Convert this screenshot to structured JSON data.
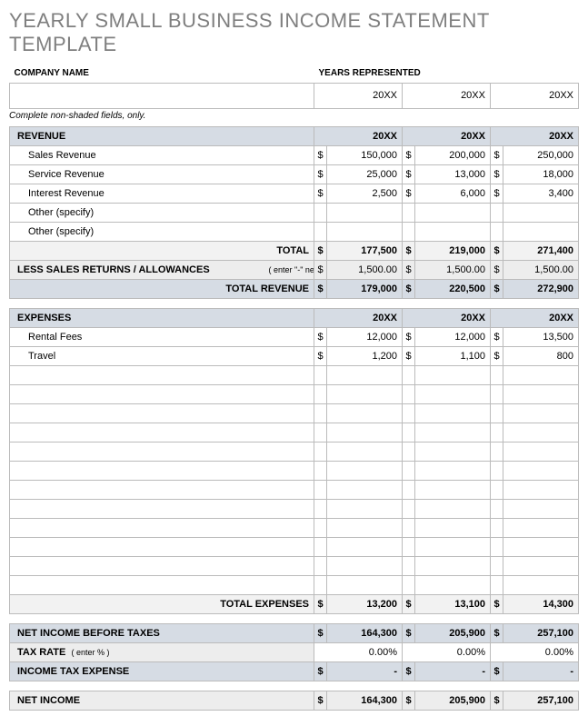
{
  "title": "YEARLY SMALL BUSINESS INCOME STATEMENT TEMPLATE",
  "header": {
    "company_label": "COMPANY NAME",
    "years_label": "YEARS REPRESENTED",
    "year1": "20XX",
    "year2": "20XX",
    "year3": "20XX"
  },
  "note": "Complete non-shaded fields, only.",
  "revenue": {
    "section_label": "REVENUE",
    "y1": "20XX",
    "y2": "20XX",
    "y3": "20XX",
    "rows": [
      {
        "label": "Sales Revenue",
        "v1": "150,000",
        "v2": "200,000",
        "v3": "250,000"
      },
      {
        "label": "Service Revenue",
        "v1": "25,000",
        "v2": "13,000",
        "v3": "18,000"
      },
      {
        "label": "Interest Revenue",
        "v1": "2,500",
        "v2": "6,000",
        "v3": "3,400"
      },
      {
        "label": "Other (specify)",
        "v1": "",
        "v2": "",
        "v3": ""
      },
      {
        "label": "Other (specify)",
        "v1": "",
        "v2": "",
        "v3": ""
      }
    ],
    "total_label": "TOTAL",
    "total": {
      "v1": "177,500",
      "v2": "219,000",
      "v3": "271,400"
    },
    "less_returns_label": "LESS SALES RETURNS / ALLOWANCES",
    "less_returns_hint": "( enter \"-\" negative amou",
    "less_returns": {
      "v1": "1,500.00",
      "v2": "1,500.00",
      "v3": "1,500.00"
    },
    "total_revenue_label": "TOTAL REVENUE",
    "total_revenue": {
      "v1": "179,000",
      "v2": "220,500",
      "v3": "272,900"
    }
  },
  "expenses": {
    "section_label": "EXPENSES",
    "y1": "20XX",
    "y2": "20XX",
    "y3": "20XX",
    "rows": [
      {
        "label": "Rental Fees",
        "v1": "12,000",
        "v2": "12,000",
        "v3": "13,500"
      },
      {
        "label": "Travel",
        "v1": "1,200",
        "v2": "1,100",
        "v3": "800"
      },
      {
        "label": "",
        "v1": "",
        "v2": "",
        "v3": ""
      },
      {
        "label": "",
        "v1": "",
        "v2": "",
        "v3": ""
      },
      {
        "label": "",
        "v1": "",
        "v2": "",
        "v3": ""
      },
      {
        "label": "",
        "v1": "",
        "v2": "",
        "v3": ""
      },
      {
        "label": "",
        "v1": "",
        "v2": "",
        "v3": ""
      },
      {
        "label": "",
        "v1": "",
        "v2": "",
        "v3": ""
      },
      {
        "label": "",
        "v1": "",
        "v2": "",
        "v3": ""
      },
      {
        "label": "",
        "v1": "",
        "v2": "",
        "v3": ""
      },
      {
        "label": "",
        "v1": "",
        "v2": "",
        "v3": ""
      },
      {
        "label": "",
        "v1": "",
        "v2": "",
        "v3": ""
      },
      {
        "label": "",
        "v1": "",
        "v2": "",
        "v3": ""
      },
      {
        "label": "",
        "v1": "",
        "v2": "",
        "v3": ""
      }
    ],
    "total_label": "TOTAL EXPENSES",
    "total": {
      "v1": "13,200",
      "v2": "13,100",
      "v3": "14,300"
    }
  },
  "summary": {
    "net_before_label": "NET INCOME BEFORE TAXES",
    "net_before": {
      "v1": "164,300",
      "v2": "205,900",
      "v3": "257,100"
    },
    "tax_rate_label": "TAX RATE",
    "tax_rate_hint": "( enter % )",
    "tax_rate": {
      "v1": "0.00%",
      "v2": "0.00%",
      "v3": "0.00%"
    },
    "tax_expense_label": "INCOME TAX EXPENSE",
    "tax_expense": {
      "v1": "-",
      "v2": "-",
      "v3": "-"
    },
    "net_income_label": "NET INCOME",
    "net_income": {
      "v1": "164,300",
      "v2": "205,900",
      "v3": "257,100"
    }
  },
  "dollar": "$"
}
